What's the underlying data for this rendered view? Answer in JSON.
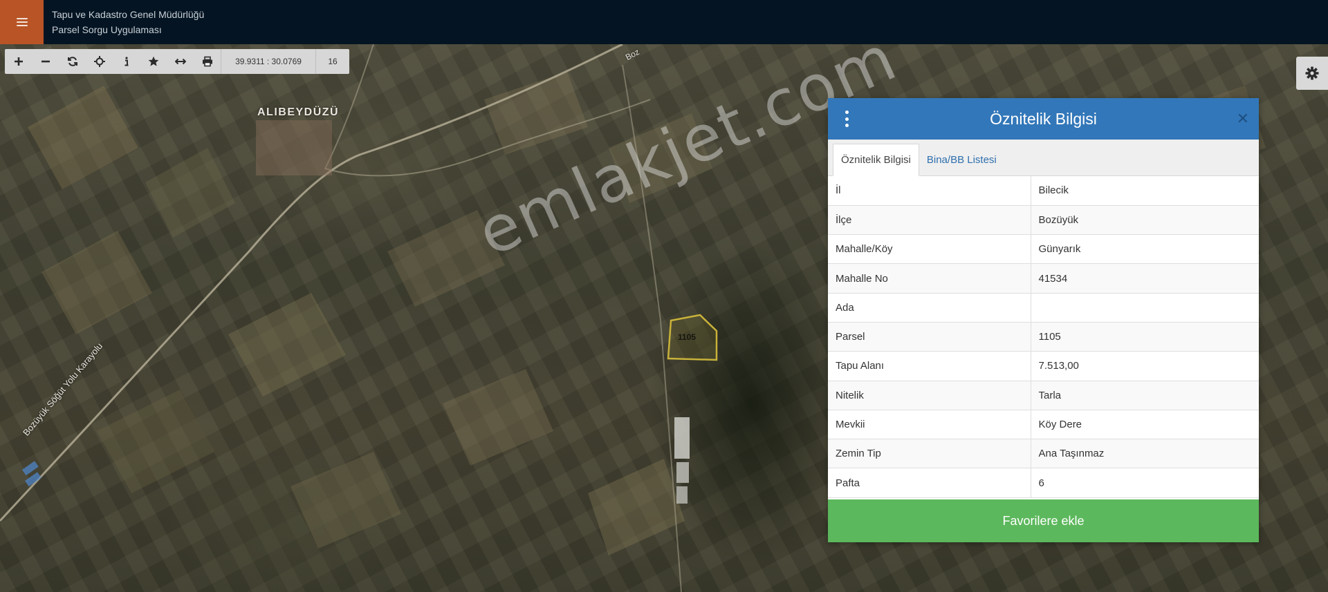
{
  "header": {
    "org_name": "Tapu ve Kadastro Genel Müdürlüğü",
    "app_name": "Parsel Sorgu Uygulaması"
  },
  "toolbar": {
    "tools": [
      "plus-icon",
      "minus-icon",
      "refresh-icon",
      "crosshair-icon",
      "info-icon",
      "star-icon",
      "measure-icon",
      "print-icon"
    ],
    "coords": "39.9311 : 30.0769",
    "zoom": "16"
  },
  "map": {
    "village_label": "ALIBEYDÜZÜ",
    "road_label_1": "Bozüyük Söğüt Yolu Karayolu",
    "road_label_2": "Boz",
    "watermark": "emlakjet.com",
    "parcel_label": "1105",
    "parcel_outline_color": "#c9b23a"
  },
  "panel": {
    "title": "Öznitelik Bilgisi",
    "tabs": [
      {
        "label": "Öznitelik Bilgisi",
        "active": true
      },
      {
        "label": "Bina/BB Listesi",
        "active": false
      }
    ],
    "rows": [
      {
        "key": "İl",
        "value": "Bilecik"
      },
      {
        "key": "İlçe",
        "value": "Bozüyük"
      },
      {
        "key": "Mahalle/Köy",
        "value": "Günyarık"
      },
      {
        "key": "Mahalle No",
        "value": "41534"
      },
      {
        "key": "Ada",
        "value": ""
      },
      {
        "key": "Parsel",
        "value": "1105"
      },
      {
        "key": "Tapu Alanı",
        "value": "7.513,00"
      },
      {
        "key": "Nitelik",
        "value": "Tarla"
      },
      {
        "key": "Mevkii",
        "value": "Köy Dere"
      },
      {
        "key": "Zemin Tip",
        "value": "Ana Taşınmaz"
      },
      {
        "key": "Pafta",
        "value": "6"
      }
    ],
    "favorite_button": "Favorilere ekle"
  },
  "colors": {
    "topbar": "#041422",
    "menu_button": "#b85426",
    "panel_header": "#3277b9",
    "favorite_button": "#5cb85c"
  }
}
